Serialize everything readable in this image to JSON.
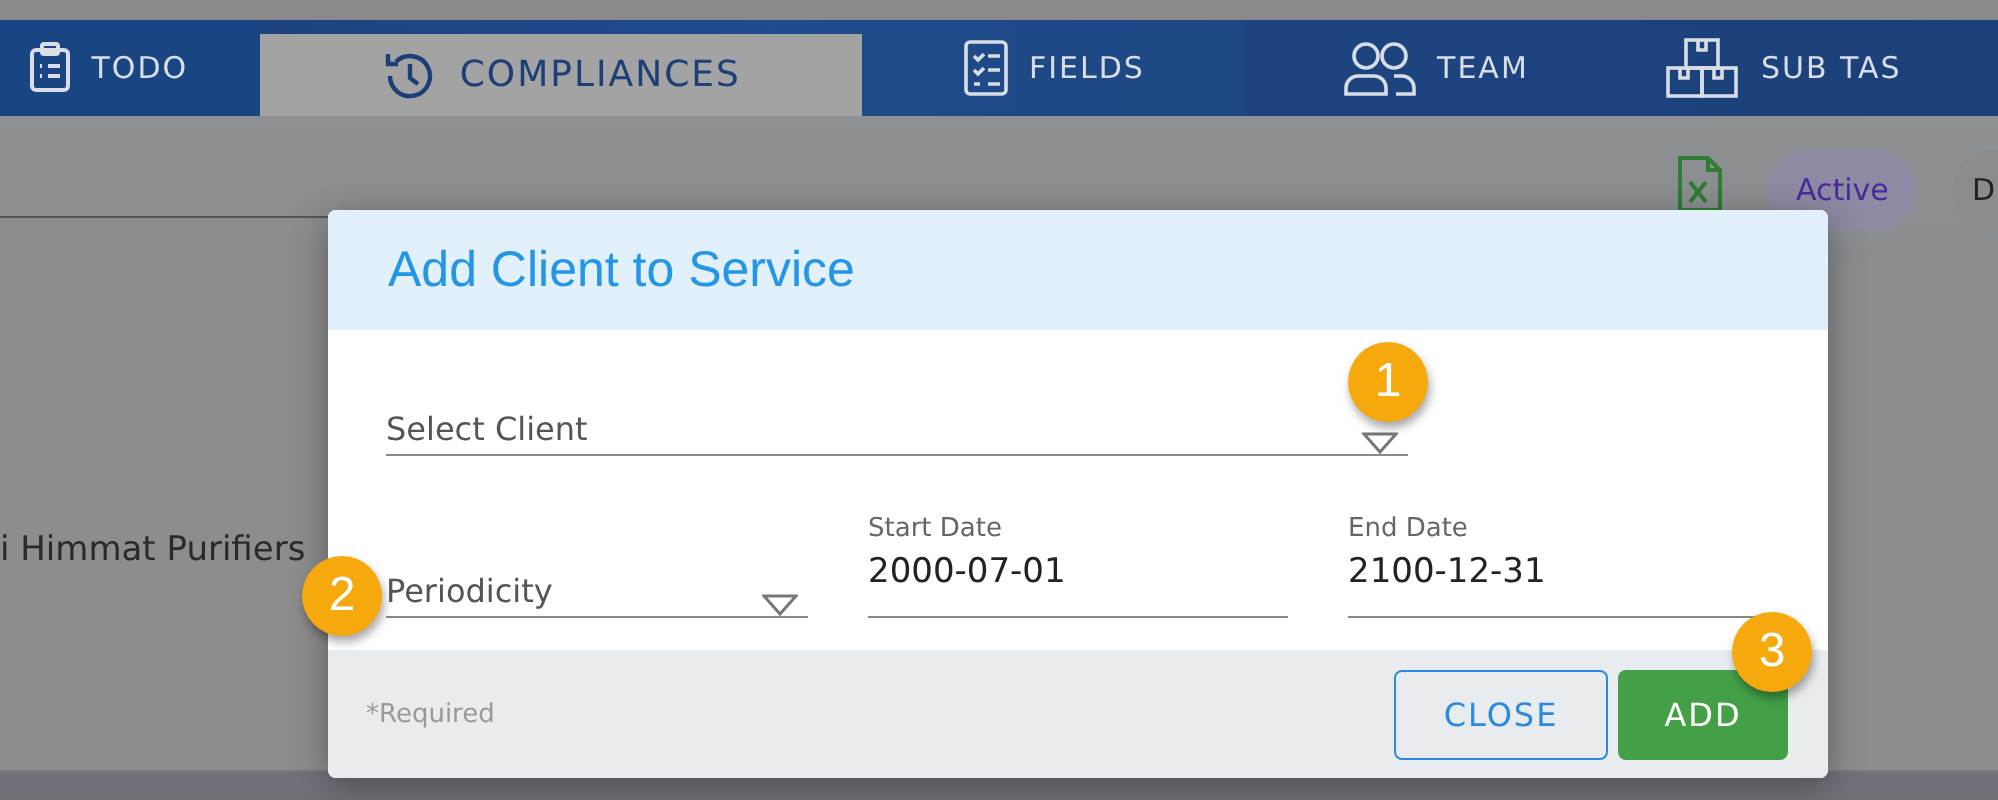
{
  "tabs": [
    {
      "label": "TODO",
      "selected": false
    },
    {
      "label": "COMPLIANCES",
      "selected": true
    },
    {
      "label": "FIELDS",
      "selected": false
    },
    {
      "label": "TEAM",
      "selected": false
    },
    {
      "label": "SUB TAS",
      "selected": false
    }
  ],
  "filters": [
    {
      "label": "Active",
      "selected": true
    },
    {
      "label": "D",
      "selected": false
    }
  ],
  "background_row": {
    "client": "i Himmat Purifiers"
  },
  "dialog": {
    "title": "Add Client to Service",
    "client_field": {
      "placeholder": "Select Client"
    },
    "periodicity_field": {
      "placeholder": "Periodicity"
    },
    "start_date": {
      "label": "Start Date",
      "value": "2000-07-01"
    },
    "end_date": {
      "label": "End Date",
      "value": "2100-12-31"
    },
    "required_note": "*Required",
    "buttons": [
      {
        "label": "CLOSE",
        "kind": "outline"
      },
      {
        "label": "ADD",
        "kind": "primary"
      }
    ]
  },
  "callouts": [
    "1",
    "2",
    "3"
  ]
}
